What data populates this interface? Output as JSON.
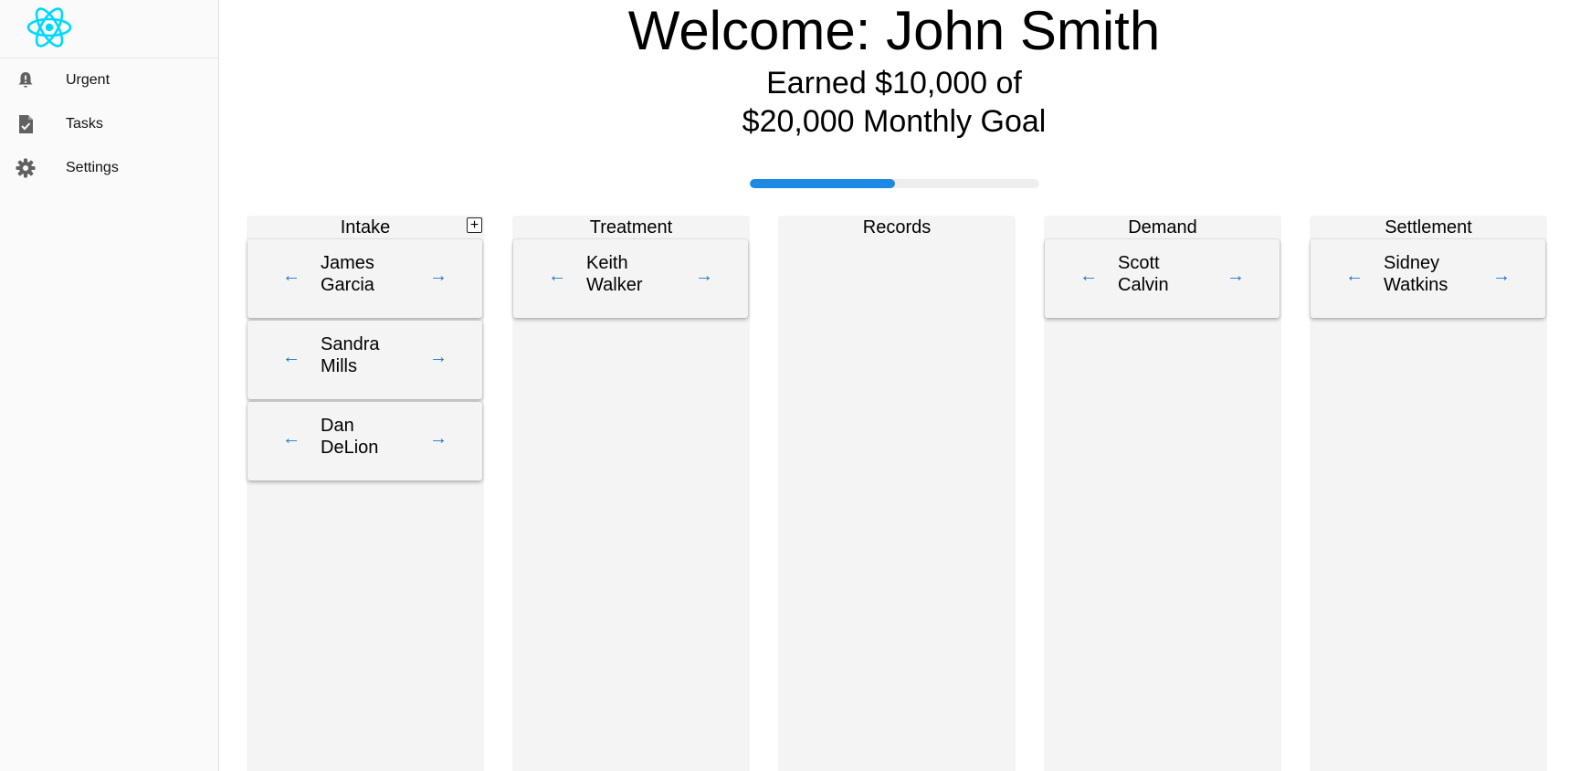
{
  "sidebar": {
    "logo": "react-logo",
    "items": [
      {
        "label": "Urgent",
        "icon": "bell-alert-icon"
      },
      {
        "label": "Tasks",
        "icon": "task-document-icon"
      },
      {
        "label": "Settings",
        "icon": "gear-icon"
      }
    ]
  },
  "header": {
    "welcome": "Welcome: John Smith",
    "goal_text": "Earned $10,000 of $20,000 Monthly Goal",
    "progress_fraction": 0.5
  },
  "colors": {
    "accent": "#1e88e5",
    "arrow": "#1976d2",
    "logo": "#00d8ff",
    "column_bg": "#f4f4f4"
  },
  "arrows": {
    "left": "←",
    "right": "→"
  },
  "add_symbol": "+",
  "columns": [
    {
      "title": "Intake",
      "cards": [
        {
          "name": "James Garcia"
        },
        {
          "name": "Sandra Mills"
        },
        {
          "name": "Dan DeLion"
        }
      ]
    },
    {
      "title": "Treatment",
      "cards": [
        {
          "name": "Keith Walker"
        }
      ]
    },
    {
      "title": "Records",
      "cards": []
    },
    {
      "title": "Demand",
      "cards": [
        {
          "name": "Scott Calvin"
        }
      ]
    },
    {
      "title": "Settlement",
      "cards": [
        {
          "name": "Sidney Watkins"
        }
      ]
    }
  ]
}
